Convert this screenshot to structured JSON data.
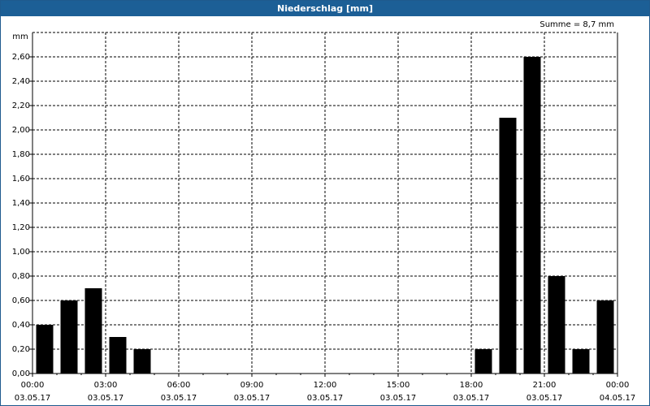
{
  "window": {
    "title": "Niederschlag [mm]"
  },
  "summary": "Summe = 8,7 mm",
  "chart_data": {
    "type": "bar",
    "title": "Niederschlag [mm]",
    "ylabel": "mm",
    "ylim": [
      0,
      2.8
    ],
    "yticks": [
      "0,00",
      "0,20",
      "0,40",
      "0,60",
      "0,80",
      "1,00",
      "1,20",
      "1,40",
      "1,60",
      "1,80",
      "2,00",
      "2,20",
      "2,40",
      "2,60"
    ],
    "xticks": [
      {
        "time": "00:00",
        "date": "03.05.17"
      },
      {
        "time": "03:00",
        "date": "03.05.17"
      },
      {
        "time": "06:00",
        "date": "03.05.17"
      },
      {
        "time": "09:00",
        "date": "03.05.17"
      },
      {
        "time": "12:00",
        "date": "03.05.17"
      },
      {
        "time": "15:00",
        "date": "03.05.17"
      },
      {
        "time": "18:00",
        "date": "03.05.17"
      },
      {
        "time": "21:00",
        "date": "03.05.17"
      },
      {
        "time": "00:00",
        "date": "04.05.17"
      }
    ],
    "grid": true,
    "bar_color": "#000000",
    "bars": [
      {
        "hour": 0,
        "value": 0.4
      },
      {
        "hour": 1,
        "value": 0.6
      },
      {
        "hour": 2,
        "value": 0.7
      },
      {
        "hour": 3,
        "value": 0.3
      },
      {
        "hour": 4,
        "value": 0.2
      },
      {
        "hour": 18,
        "value": 0.2
      },
      {
        "hour": 19,
        "value": 2.1
      },
      {
        "hour": 20,
        "value": 2.6
      },
      {
        "hour": 21,
        "value": 0.8
      },
      {
        "hour": 22,
        "value": 0.2
      },
      {
        "hour": 23,
        "value": 0.6
      }
    ]
  }
}
